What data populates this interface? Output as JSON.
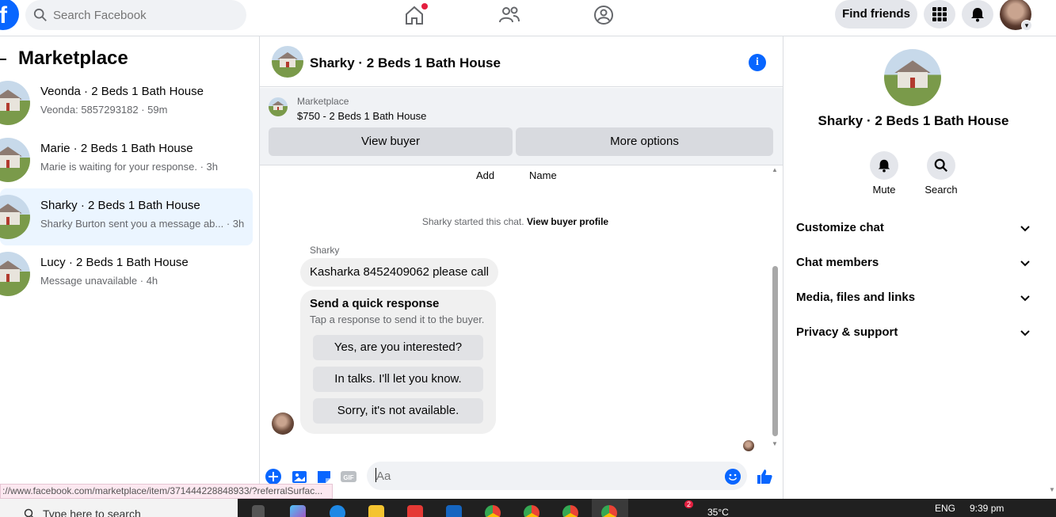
{
  "topbar": {
    "logo": "f",
    "search_placeholder": "Search Facebook",
    "find_friends": "Find friends"
  },
  "left": {
    "title": "Marketplace",
    "conversations": [
      {
        "title": "Veonda · 2 Beds 1 Bath House",
        "sub": "Veonda: 5857293182 · 59m",
        "active": false
      },
      {
        "title": "Marie · 2 Beds 1 Bath House",
        "sub": "Marie is waiting for your response. · 3h",
        "active": false
      },
      {
        "title": "Sharky · 2 Beds 1 Bath House",
        "sub": "Sharky Burton sent you a message ab... · 3h",
        "active": true
      },
      {
        "title": "Lucy · 2 Beds 1 Bath House",
        "sub": "Message unavailable · 4h",
        "active": false
      }
    ]
  },
  "chat": {
    "title": "Sharky · 2 Beds 1 Bath House",
    "info_icon": "i",
    "listing": {
      "category": "Marketplace",
      "price_title": "$750 - 2 Beds 1 Bath House",
      "view_buyer": "View buyer",
      "more_options": "More options"
    },
    "add_label": "Add",
    "name_label": "Name",
    "started_prefix": "Sharky started this chat.",
    "started_link": "View buyer profile",
    "sender": "Sharky",
    "message": "Kasharka 8452409062 please call",
    "quick": {
      "title": "Send a quick response",
      "subtitle": "Tap a response to send it to the buyer.",
      "options": [
        "Yes, are you interested?",
        "In talks. I'll let you know.",
        "Sorry, it's not available."
      ]
    },
    "composer_placeholder": "Aa",
    "gif_label": "GIF"
  },
  "right": {
    "name": "Sharky · 2 Beds 1 Bath House",
    "mute": "Mute",
    "search": "Search",
    "sections": [
      "Customize chat",
      "Chat members",
      "Media, files and links",
      "Privacy & support"
    ]
  },
  "status_url": "://www.facebook.com/marketplace/item/371444228848933/?referralSurfac...",
  "taskbar": {
    "search_text": "Type here to search",
    "badge": "2",
    "temperature": "35°C",
    "language": "ENG",
    "time": "9:39 pm"
  },
  "colors": {
    "brand": "#0866ff",
    "notification": "#e41e3f",
    "active_row": "#ebf5ff"
  }
}
